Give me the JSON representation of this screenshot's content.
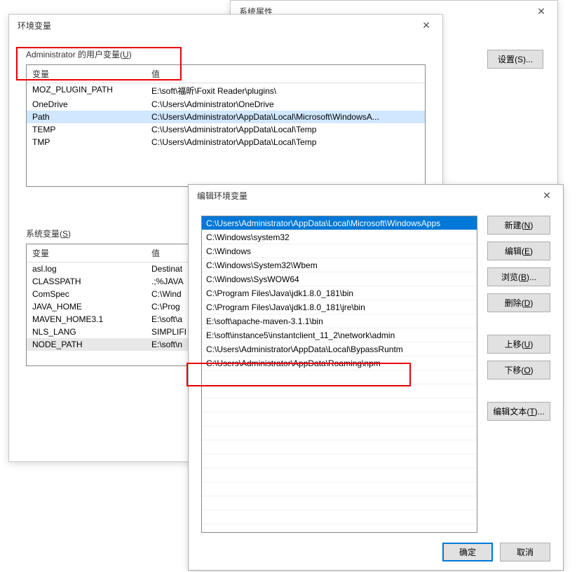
{
  "sysWindow": {
    "title": "系统属性",
    "settingsBtn": "设置(S)..."
  },
  "envWindow": {
    "title": "环境变量",
    "userVarsTitle_prefix": "Administrator 的用户变量(",
    "userVarsTitle_u": "U",
    "userVarsTitle_suffix": ")",
    "sysVarsTitle_prefix": "系统变量(",
    "sysVarsTitle_u": "S",
    "sysVarsTitle_suffix": ")",
    "colVar": "变量",
    "colVal": "值",
    "userVars": [
      {
        "name": "MOZ_PLUGIN_PATH",
        "value": "E:\\soft\\福昕\\Foxit Reader\\plugins\\"
      },
      {
        "name": "OneDrive",
        "value": "C:\\Users\\Administrator\\OneDrive"
      },
      {
        "name": "Path",
        "value": "C:\\Users\\Administrator\\AppData\\Local\\Microsoft\\WindowsA...",
        "selected": true
      },
      {
        "name": "TEMP",
        "value": "C:\\Users\\Administrator\\AppData\\Local\\Temp"
      },
      {
        "name": "TMP",
        "value": "C:\\Users\\Administrator\\AppData\\Local\\Temp"
      }
    ],
    "sysVars": [
      {
        "name": "asl.log",
        "value": "Destinat"
      },
      {
        "name": "CLASSPATH",
        "value": ".;%JAVA"
      },
      {
        "name": "ComSpec",
        "value": "C:\\Wind"
      },
      {
        "name": "JAVA_HOME",
        "value": "C:\\Prog"
      },
      {
        "name": "MAVEN_HOME3.1",
        "value": "E:\\soft\\a"
      },
      {
        "name": "NLS_LANG",
        "value": "SIMPLIFI"
      },
      {
        "name": "NODE_PATH",
        "value": "E:\\soft\\n",
        "selected": true
      }
    ]
  },
  "editWindow": {
    "title": "编辑环境变量",
    "items": [
      {
        "text": "C:\\Users\\Administrator\\AppData\\Local\\Microsoft\\WindowsApps",
        "selected": true
      },
      {
        "text": "C:\\Windows\\system32"
      },
      {
        "text": "C:\\Windows"
      },
      {
        "text": "C:\\Windows\\System32\\Wbem"
      },
      {
        "text": "C:\\Windows\\SysWOW64"
      },
      {
        "text": "C:\\Program Files\\Java\\jdk1.8.0_181\\bin"
      },
      {
        "text": "C:\\Program Files\\Java\\jdk1.8.0_181\\jre\\bin"
      },
      {
        "text": "E:\\soft\\apache-maven-3.1.1\\bin"
      },
      {
        "text": "E:\\soft\\instance5\\instantclient_11_2\\network\\admin"
      },
      {
        "text": "C:\\Users\\Administrator\\AppData\\Local\\BypassRuntm"
      },
      {
        "text": "C:\\Users\\Administrator\\AppData\\Roaming\\npm"
      }
    ],
    "buttons": {
      "new": {
        "label": "新建(",
        "u": "N",
        "suffix": ")"
      },
      "edit": {
        "label": "编辑(",
        "u": "E",
        "suffix": ")"
      },
      "browse": {
        "label": "浏览(",
        "u": "B",
        "suffix": ")..."
      },
      "delete": {
        "label": "删除(",
        "u": "D",
        "suffix": ")"
      },
      "up": {
        "label": "上移(",
        "u": "U",
        "suffix": ")"
      },
      "down": {
        "label": "下移(",
        "u": "O",
        "suffix": ")"
      },
      "editText": {
        "label": "编辑文本(",
        "u": "T",
        "suffix": ")..."
      }
    },
    "ok": "确定",
    "cancel": "取消"
  }
}
